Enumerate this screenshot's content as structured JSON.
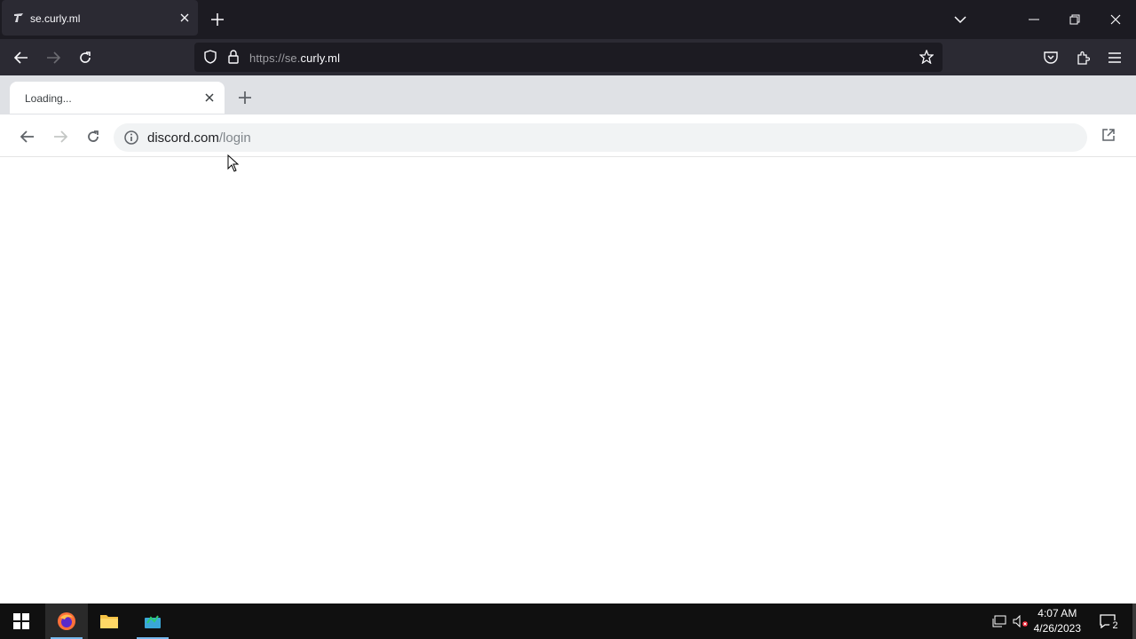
{
  "outer_browser": {
    "tab_title": "se.curly.ml",
    "url_scheme": "https://se.",
    "url_host": "curly.ml"
  },
  "inner_app": {
    "tab_title": "Loading...",
    "url_host": "discord.com",
    "url_path": "/login"
  },
  "taskbar": {
    "time": "4:07 AM",
    "date": "4/26/2023",
    "notification_count": "2"
  },
  "colors": {
    "outer_tabbar": "#1c1b22",
    "outer_navbar": "#2b2a33",
    "inner_tabbar": "#dfe1e5",
    "taskbar": "#101010",
    "accent": "#76b9ed"
  }
}
